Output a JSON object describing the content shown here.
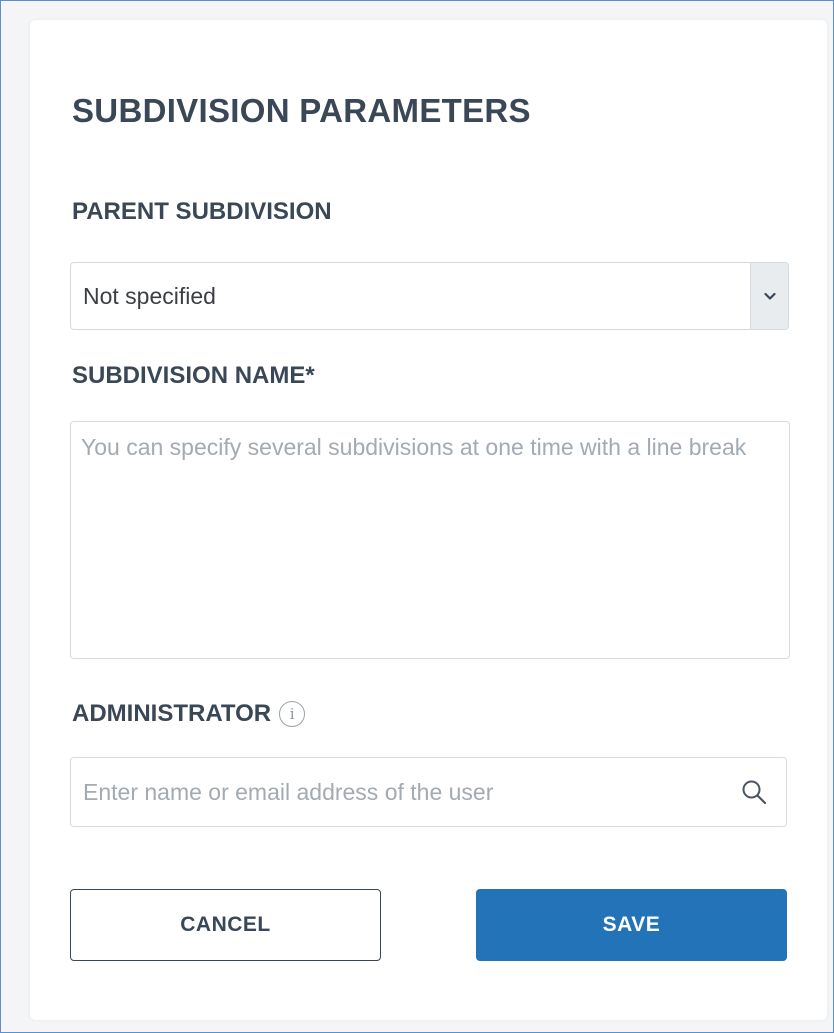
{
  "form": {
    "title": "SUBDIVISION PARAMETERS",
    "parent": {
      "label": "PARENT SUBDIVISION",
      "selected": "Not specified"
    },
    "name": {
      "label": "SUBDIVISION NAME*",
      "value": "",
      "placeholder": "You can specify several subdivisions at one time with a line break"
    },
    "admin": {
      "label": "ADMINISTRATOR",
      "info_glyph": "i",
      "value": "",
      "placeholder": "Enter name or email address of the user"
    }
  },
  "actions": {
    "cancel_label": "CANCEL",
    "save_label": "SAVE"
  },
  "icons": {
    "dropdown": "chevron-down-icon",
    "info": "info-icon",
    "search": "search-icon"
  },
  "colors": {
    "accent": "#2373b9",
    "heading": "#3a4756",
    "border": "#d6dbe0",
    "placeholder": "#a3aab1",
    "frame": "#5b8fd1"
  }
}
